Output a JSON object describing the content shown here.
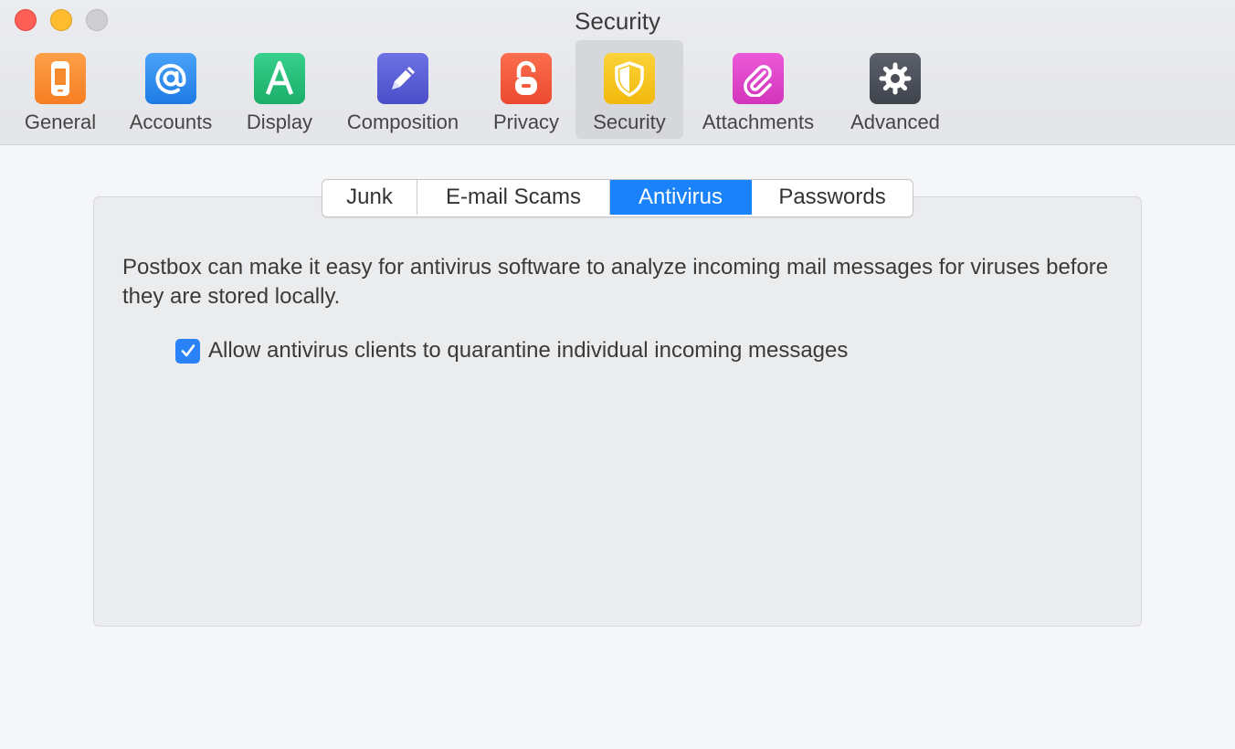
{
  "window": {
    "title": "Security"
  },
  "toolbar": {
    "items": [
      {
        "label": "General",
        "icon": "phone-icon",
        "color": "#fb8a2e"
      },
      {
        "label": "Accounts",
        "icon": "at-sign-icon",
        "color": "#2f8ef0"
      },
      {
        "label": "Display",
        "icon": "letter-a-icon",
        "color": "#26c07a"
      },
      {
        "label": "Composition",
        "icon": "pencil-icon",
        "color": "#5b5fd6"
      },
      {
        "label": "Privacy",
        "icon": "open-lock-icon",
        "color": "#f4593f"
      },
      {
        "label": "Security",
        "icon": "shield-icon",
        "color": "#f7c318"
      },
      {
        "label": "Attachments",
        "icon": "paperclip-icon",
        "color": "#e040c8"
      },
      {
        "label": "Advanced",
        "icon": "gear-icon",
        "color": "#4a4e58"
      }
    ],
    "active": "Security"
  },
  "tabs": {
    "items": [
      "Junk",
      "E-mail Scams",
      "Antivirus",
      "Passwords"
    ],
    "active": "Antivirus",
    "accent": "#1a82fb"
  },
  "antivirus": {
    "description": "Postbox can make it easy for antivirus software to analyze incoming mail messages for viruses before they are stored locally.",
    "quarantine_label": "Allow antivirus clients to quarantine individual incoming messages",
    "quarantine_checked": true
  }
}
